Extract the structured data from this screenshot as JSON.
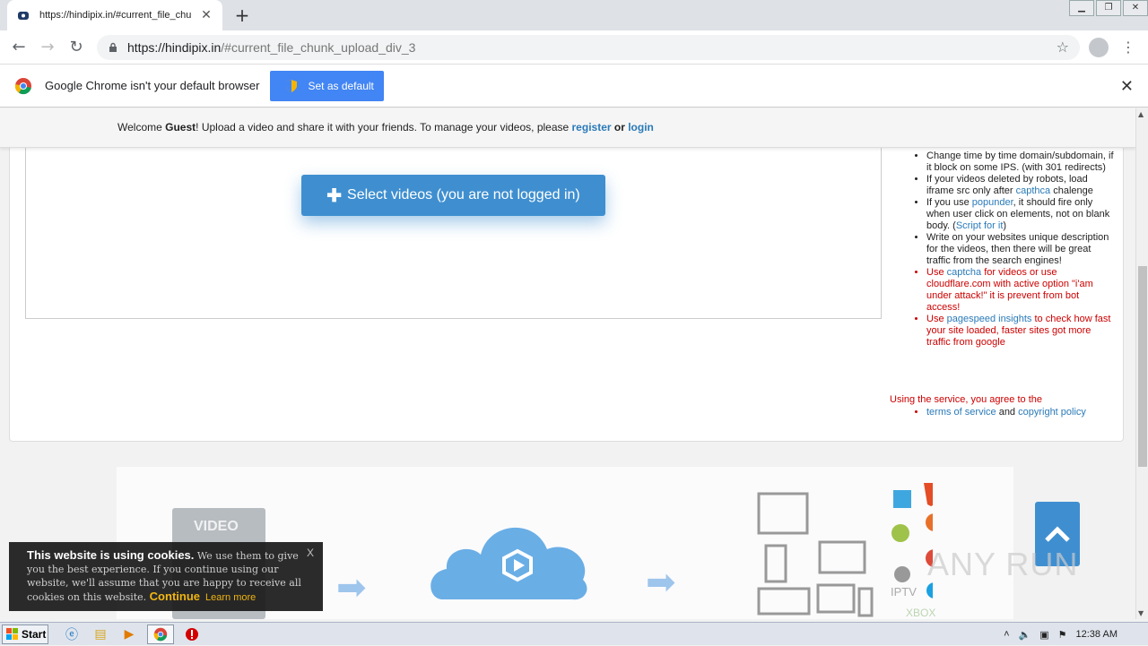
{
  "browser": {
    "tab_title": "https://hindipix.in/#current_file_chu",
    "url_host": "https://hindipix.in",
    "url_path": "/#current_file_chunk_upload_div_3",
    "infobar_text": "Google Chrome isn't your default browser",
    "set_default_label": "Set as default"
  },
  "welcome": {
    "prefix": "Welcome ",
    "user": "Guest",
    "middle": "! Upload a video and share it with your friends. To manage your videos, please ",
    "register": "register",
    "or": " or ",
    "login": "login"
  },
  "upload": {
    "button_label": "Select videos (you are not logged in)"
  },
  "tips": {
    "item1": "Change time by time domain/subdomain, if it block on some IPS. (with 301 redirects)",
    "item2_a": "If your videos deleted by robots, load iframe src only after ",
    "item2_link": "capthca",
    "item2_b": " chalenge",
    "item3_a": "If you use ",
    "item3_link": "popunder",
    "item3_b": ", it should fire only when user click on elements, not on blank body. (",
    "item3_link2": "Script for it",
    "item3_c": ")",
    "item4": "Write on your websites unique description for the videos, then there will be great traffic from the search engines!",
    "item5_a": "Use ",
    "item5_link": "captcha",
    "item5_b": " for videos or use cloudflare.com with active option \"i'am under attack!\" it is prevent from bot access!",
    "item6_a": "Use ",
    "item6_link": "pagespeed insights",
    "item6_b": " to check how fast your site loaded, faster sites got more traffic from google"
  },
  "agreement": {
    "heading": "Using the service, you agree to the",
    "terms": "terms of service",
    "and": " and ",
    "copyright": "copyright policy"
  },
  "illustration": {
    "video_label": "VIDEO",
    "iptv": "IPTV",
    "xbox": "XBOX"
  },
  "watermark": "ANY RUN",
  "cookie": {
    "title": "This website is using cookies.",
    "body": " We use them to give you the best experience. If you continue using our website, we'll assume that you are happy to receive all cookies on this website.",
    "continue": "Continue",
    "learn_more": "Learn more",
    "close": "X"
  },
  "taskbar": {
    "start": "Start",
    "time": "12:38 AM"
  },
  "colors": {
    "accent": "#3f8fd0",
    "link": "#2a7ab8",
    "warning_red": "#cc0000",
    "cookie_highlight": "#f4b400"
  }
}
